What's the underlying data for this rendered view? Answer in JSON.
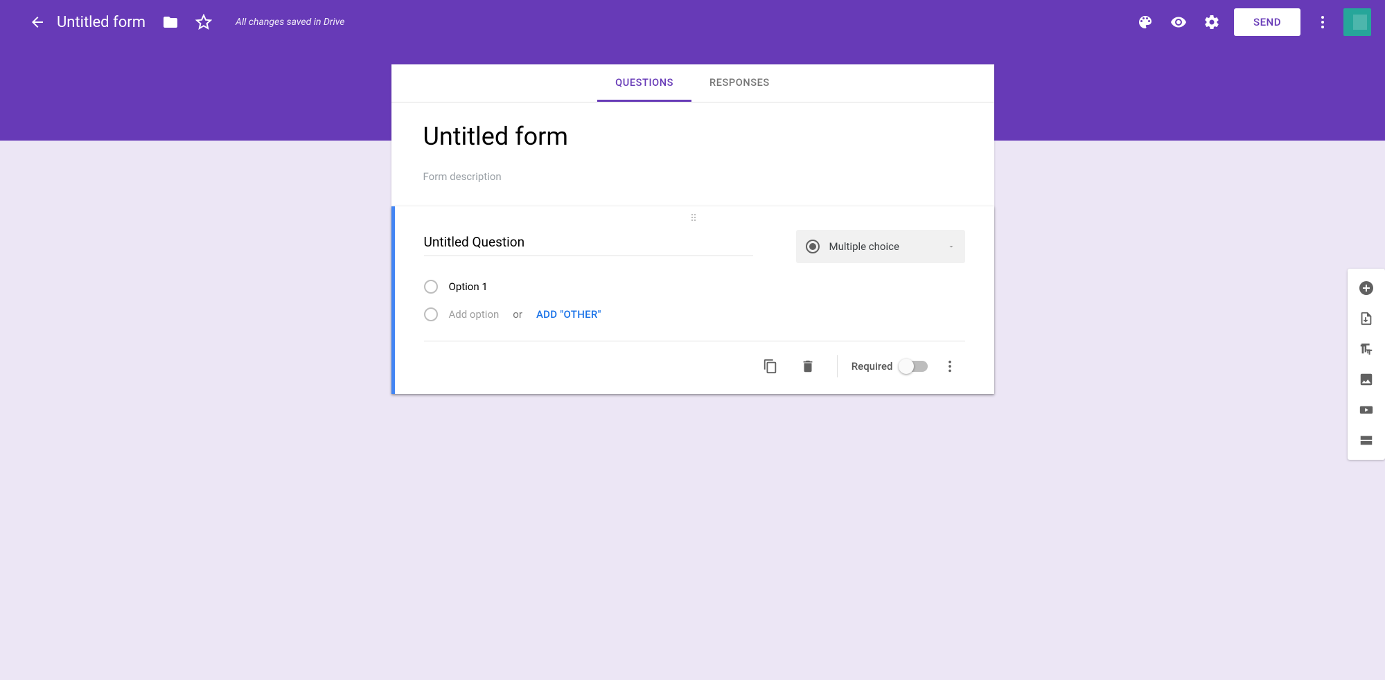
{
  "header": {
    "doc_title": "Untitled form",
    "save_status": "All changes saved in Drive",
    "send_label": "SEND"
  },
  "tabs": {
    "questions": "QUESTIONS",
    "responses": "RESPONSES"
  },
  "title_card": {
    "title": "Untitled form",
    "desc_placeholder": "Form description"
  },
  "question": {
    "title": "Untitled Question",
    "type_label": "Multiple choice",
    "option1": "Option 1",
    "add_option": "Add option",
    "or": "or",
    "add_other": "ADD \"OTHER\"",
    "required_label": "Required"
  }
}
